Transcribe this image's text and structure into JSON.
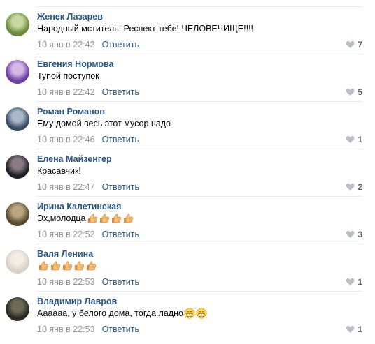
{
  "comments": [
    {
      "author": "Женек Лазарев",
      "text": "Народный мститель! Респект тебе! ЧЕЛОВЕЧИЩЕ!!!!",
      "emoji_count": 0,
      "emoji_icon": "",
      "date": "10 янв в 22:42",
      "reply": "Ответить",
      "likes": "7",
      "avatar_colors": [
        "#6b8a3a",
        "#c8d8a0"
      ]
    },
    {
      "author": "Евгения Нормова",
      "text": "Тупой поступок",
      "emoji_count": 0,
      "emoji_icon": "",
      "date": "10 янв в 22:42",
      "reply": "Ответить",
      "likes": "5",
      "avatar_colors": [
        "#6a3fa0",
        "#d7b7e8"
      ]
    },
    {
      "author": "Роман Романов",
      "text": "Ему домой весь этот мусор надо",
      "emoji_count": 0,
      "emoji_icon": "",
      "date": "10 янв в 22:46",
      "reply": "Ответить",
      "likes": "1",
      "avatar_colors": [
        "#3a4b62",
        "#a9b8c9"
      ]
    },
    {
      "author": "Елена Майзенгер",
      "text": "Красавчик!",
      "emoji_count": 0,
      "emoji_icon": "",
      "date": "10 янв в 22:47",
      "reply": "Ответить",
      "likes": "2",
      "avatar_colors": [
        "#1e1e24",
        "#8a7a86"
      ]
    },
    {
      "author": "Ирина Калетинская",
      "text": "Эх,молодца",
      "emoji_count": 4,
      "emoji_icon": "thumbs-up-emoji",
      "date": "10 янв в 22:52",
      "reply": "Ответить",
      "likes": "3",
      "avatar_colors": [
        "#5a4a2e",
        "#b8a680"
      ]
    },
    {
      "author": "Валя Ленина",
      "text": "",
      "emoji_count": 5,
      "emoji_icon": "thumbs-up-emoji",
      "date": "10 янв в 22:53",
      "reply": "Ответить",
      "likes": "1",
      "avatar_colors": [
        "#d8d2c6",
        "#f2eee6"
      ]
    },
    {
      "author": "Владимир Лавров",
      "text": "Аааааа, у белого дома, тогда ладно",
      "emoji_count": 2,
      "emoji_icon": "grinning-face-emoji",
      "date": "10 янв в 22:53",
      "reply": "Ответить",
      "likes": "1",
      "avatar_colors": [
        "#2a2a22",
        "#6d6b55"
      ]
    }
  ],
  "colors": {
    "author": "#2a5885",
    "date": "#939393",
    "reply": "#2a5885",
    "likes": "#656565",
    "heart": "#b8bec6",
    "divider": "#e7e8ec"
  }
}
